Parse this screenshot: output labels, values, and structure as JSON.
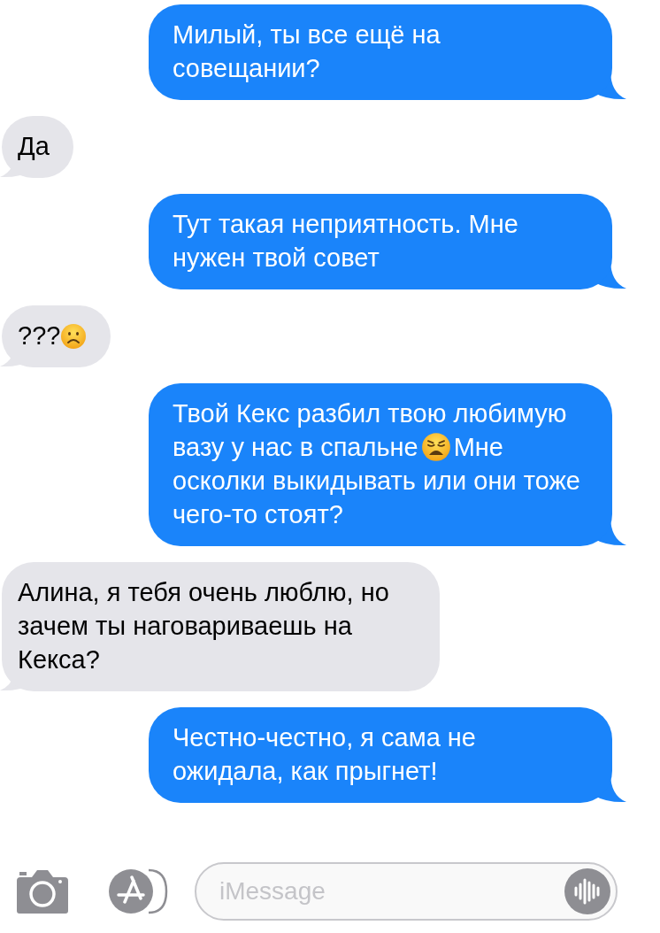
{
  "messages": [
    {
      "kind": "sent",
      "parts": [
        {
          "kind": "text",
          "text": "Милый, ты все ещё на совещании?"
        }
      ]
    },
    {
      "kind": "received",
      "parts": [
        {
          "kind": "text",
          "text": "Да"
        }
      ]
    },
    {
      "kind": "sent",
      "parts": [
        {
          "kind": "text",
          "text": "Тут такая неприятность. Мне нужен твой совет"
        }
      ]
    },
    {
      "kind": "received",
      "parts": [
        {
          "kind": "text",
          "text": "???"
        },
        {
          "kind": "frown"
        }
      ]
    },
    {
      "kind": "sent",
      "parts": [
        {
          "kind": "text",
          "text": "Твой Кекс разбил твою любимую вазу у нас в спальне"
        },
        {
          "kind": "weary"
        },
        {
          "kind": "text",
          "text": "Мне осколки выкидывать или они тоже чего-то стоят?"
        }
      ]
    },
    {
      "kind": "received",
      "parts": [
        {
          "kind": "text",
          "text": "Алина, я тебя очень люблю, но зачем ты наговариваешь на Кекса?"
        }
      ]
    },
    {
      "kind": "sent",
      "parts": [
        {
          "kind": "text",
          "text": "Честно-честно, я сама не ожидала, как прыгнет!"
        }
      ]
    }
  ],
  "composer": {
    "placeholder": "iMessage"
  }
}
